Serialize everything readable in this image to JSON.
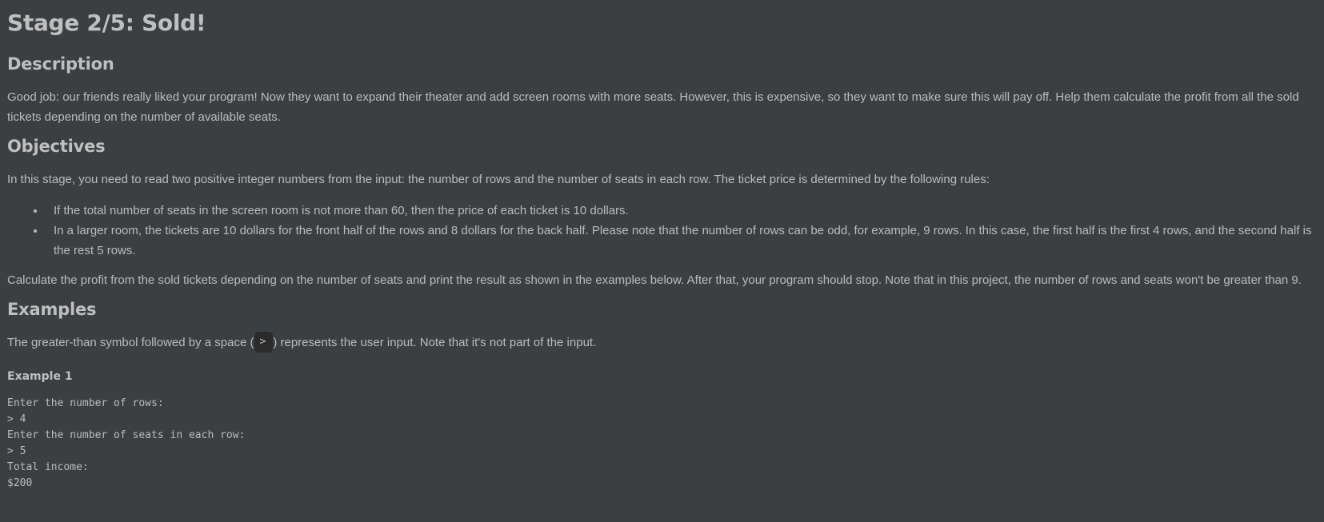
{
  "title": "Stage 2/5: Sold!",
  "description": {
    "heading": "Description",
    "text": "Good job: our friends really liked your program! Now they want to expand their theater and add screen rooms with more seats. However, this is expensive, so they want to make sure this will pay off. Help them calculate the profit from all the sold tickets depending on the number of available seats."
  },
  "objectives": {
    "heading": "Objectives",
    "intro": "In this stage, you need to read two positive integer numbers from the input: the number of rows and the number of seats in each row. The ticket price is determined by the following rules:",
    "rules": [
      "If the total number of seats in the screen room is not more than 60, then the price of each ticket is 10 dollars.",
      "In a larger room, the tickets are 10 dollars for the front half of the rows and 8 dollars for the back half. Please note that the number of rows can be odd, for example, 9 rows. In this case, the first half is the first 4 rows, and the second half is the rest 5 rows."
    ],
    "outro": "Calculate the profit from the sold tickets depending on the number of seats and print the result as shown in the examples below. After that, your program should stop. Note that in this project, the number of rows and seats won't be greater than 9."
  },
  "examples": {
    "heading": "Examples",
    "intro_before": "The greater-than symbol followed by a space (",
    "intro_code": ">",
    "intro_after": ") represents the user input. Note that it's not part of the input.",
    "example1": {
      "heading": "Example 1",
      "lines": [
        "Enter the number of rows:",
        "> 4",
        "Enter the number of seats in each row:",
        "> 5",
        "Total income:",
        "$200"
      ]
    }
  }
}
